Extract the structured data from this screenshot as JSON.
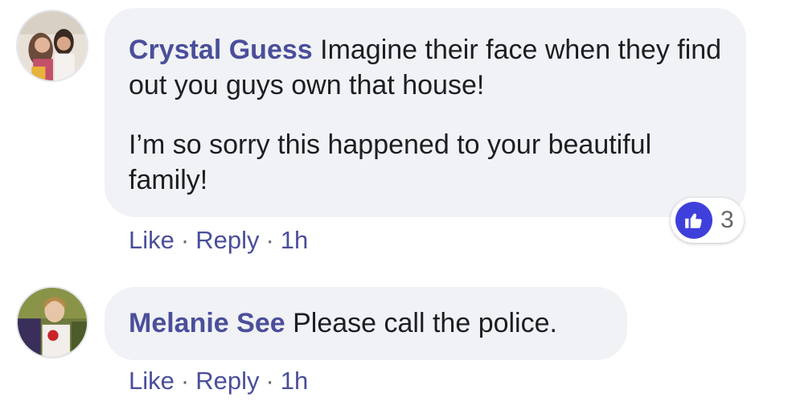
{
  "comments": [
    {
      "author": "Crystal Guess",
      "paragraph1": "Imagine their face when they find out you guys own that house!",
      "paragraph2": "I’m so sorry this happened to your beautiful family!",
      "actions": {
        "like": "Like",
        "separator": "·",
        "reply": "Reply",
        "time": "1h"
      },
      "reaction": {
        "icon": "thumbs-up-icon",
        "count": "3"
      }
    },
    {
      "author": "Melanie See",
      "paragraph1": "Please call the police.",
      "actions": {
        "like": "Like",
        "separator": "·",
        "reply": "Reply",
        "time": "1h"
      }
    }
  ],
  "colors": {
    "author": "#4b4f9a",
    "bubble": "#f0f2f5",
    "like_badge": "#3f3fdc"
  }
}
